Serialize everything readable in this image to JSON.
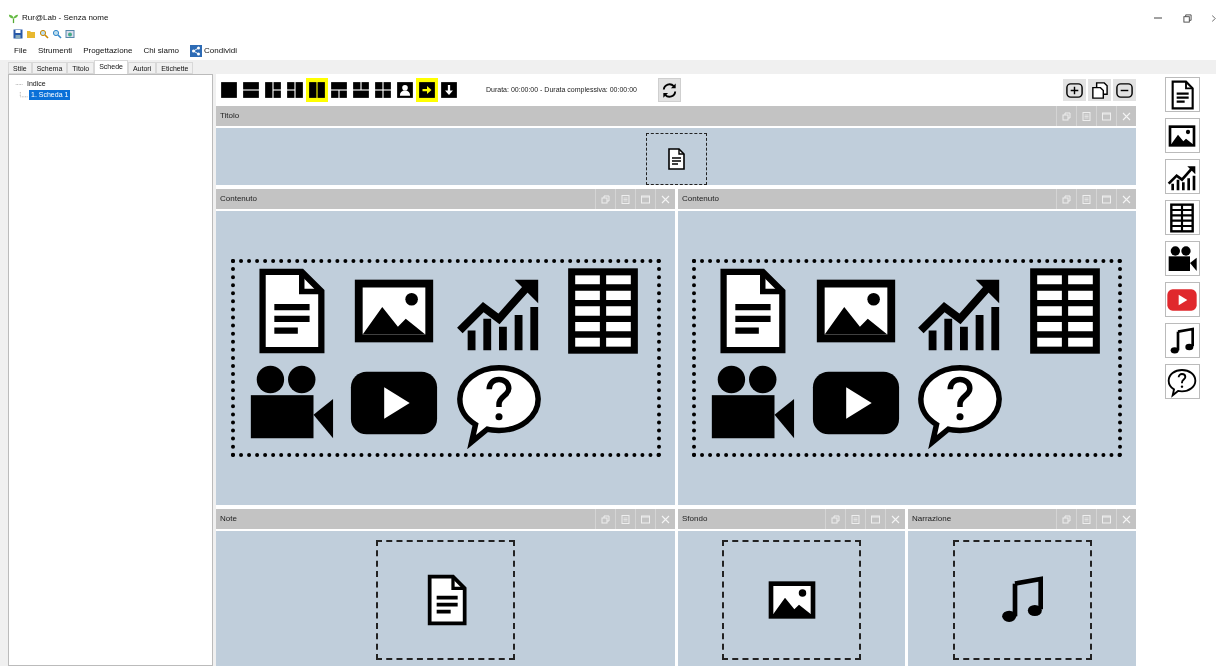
{
  "window": {
    "title": "Rur@Lab - Senza nome"
  },
  "menu": [
    {
      "label": "File",
      "kind": "text"
    },
    {
      "label": "Strumenti",
      "kind": "text"
    },
    {
      "label": "Progettazione",
      "kind": "text"
    },
    {
      "label": "Chi siamo",
      "kind": "text"
    },
    {
      "label": "Condividi",
      "kind": "share"
    }
  ],
  "tabs": [
    {
      "label": "Stile",
      "selected": false
    },
    {
      "label": "Schema",
      "selected": false
    },
    {
      "label": "Titolo",
      "selected": false
    },
    {
      "label": "Schede",
      "selected": true
    },
    {
      "label": "Autori",
      "selected": false
    },
    {
      "label": "Etichette",
      "selected": false
    }
  ],
  "tree": [
    {
      "label": "Indice",
      "selected": false,
      "children": [
        {
          "label": "1. Scheda 1",
          "selected": true
        }
      ]
    }
  ],
  "layout_buttons": [
    {
      "kind": "single",
      "selected": false
    },
    {
      "kind": "two-rows",
      "selected": false
    },
    {
      "kind": "left-split",
      "selected": false
    },
    {
      "kind": "quad-split",
      "selected": false
    },
    {
      "kind": "two-columns",
      "selected": true
    },
    {
      "kind": "top-split",
      "selected": false
    },
    {
      "kind": "bottom-split",
      "selected": false
    },
    {
      "kind": "four",
      "selected": false
    },
    {
      "kind": "portrait",
      "selected": false
    },
    {
      "kind": "arrow-right",
      "selected": true
    },
    {
      "kind": "arrow-down",
      "selected": false
    }
  ],
  "duration": "Durata: 00:00:00 - Durata complessiva: 00:00:00",
  "panel_rows": [
    {
      "panels": [
        {
          "title": "Titolo",
          "kind": "single",
          "elements": [
            {
              "kind": "text"
            }
          ]
        }
      ]
    },
    {
      "panels": [
        {
          "title": "Contenuto",
          "kind": "multi",
          "elements": [
            {
              "kind": "text"
            },
            {
              "kind": "image"
            },
            {
              "kind": "chart"
            },
            {
              "kind": "table"
            },
            {
              "kind": "camera"
            },
            {
              "kind": "play"
            },
            {
              "kind": "quiz"
            }
          ]
        },
        {
          "title": "Contenuto",
          "kind": "multi",
          "elements": [
            {
              "kind": "text"
            },
            {
              "kind": "image"
            },
            {
              "kind": "chart"
            },
            {
              "kind": "table"
            },
            {
              "kind": "camera"
            },
            {
              "kind": "play"
            },
            {
              "kind": "quiz"
            }
          ]
        }
      ]
    },
    {
      "panels": [
        {
          "title": "Note",
          "kind": "single",
          "elements": [
            {
              "kind": "text"
            }
          ]
        },
        {
          "title": "Sfondo",
          "kind": "single",
          "elements": [
            {
              "kind": "image"
            }
          ]
        },
        {
          "title": "Narrazione",
          "kind": "single",
          "elements": [
            {
              "kind": "audio"
            }
          ]
        }
      ]
    }
  ],
  "palette": [
    {
      "kind": "text"
    },
    {
      "kind": "image"
    },
    {
      "kind": "chart"
    },
    {
      "kind": "table"
    },
    {
      "kind": "camera"
    },
    {
      "kind": "youtube"
    },
    {
      "kind": "audio"
    },
    {
      "kind": "quiz"
    }
  ]
}
